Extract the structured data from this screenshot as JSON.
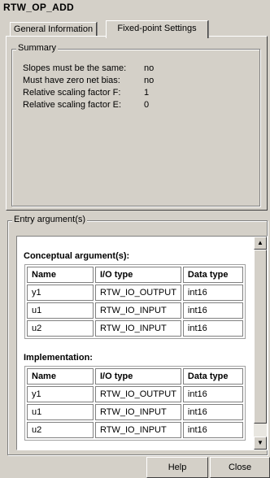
{
  "window": {
    "title": "RTW_OP_ADD"
  },
  "tabs": [
    {
      "label": "General Information",
      "active": false
    },
    {
      "label": "Fixed-point Settings",
      "active": true
    }
  ],
  "summary": {
    "group_label": "Summary",
    "rows": [
      {
        "label": "Slopes must be the same:",
        "value": "no"
      },
      {
        "label": "Must have zero net bias:",
        "value": "no"
      },
      {
        "label": "Relative scaling factor F:",
        "value": "1"
      },
      {
        "label": "Relative scaling factor E:",
        "value": "0"
      }
    ]
  },
  "entry": {
    "group_label": "Entry argument(s)",
    "conceptual": {
      "title": "Conceptual argument(s):",
      "headers": [
        "Name",
        "I/O type",
        "Data type"
      ],
      "rows": [
        [
          "y1",
          "RTW_IO_OUTPUT",
          "int16"
        ],
        [
          "u1",
          "RTW_IO_INPUT",
          "int16"
        ],
        [
          "u2",
          "RTW_IO_INPUT",
          "int16"
        ]
      ]
    },
    "implementation": {
      "title": "Implementation:",
      "headers": [
        "Name",
        "I/O type",
        "Data type"
      ],
      "rows": [
        [
          "y1",
          "RTW_IO_OUTPUT",
          "int16"
        ],
        [
          "u1",
          "RTW_IO_INPUT",
          "int16"
        ],
        [
          "u2",
          "RTW_IO_INPUT",
          "int16"
        ]
      ]
    }
  },
  "buttons": {
    "help": "Help",
    "close": "Close"
  },
  "icons": {
    "scroll_up": "scroll-up-arrow-icon",
    "scroll_down": "scroll-down-arrow-icon"
  }
}
